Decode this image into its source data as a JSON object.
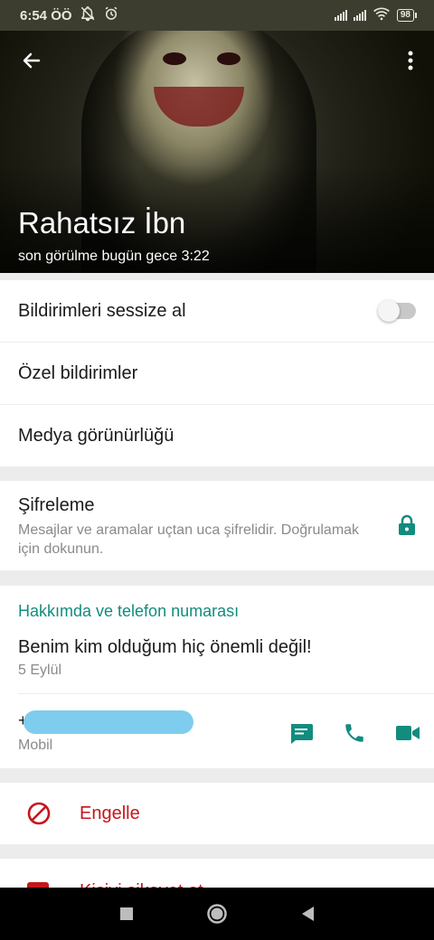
{
  "status_bar": {
    "time": "6:54 ÖÖ",
    "battery": "98"
  },
  "header": {
    "contact_name": "Rahatsız İbn",
    "last_seen": "son görülme bugün gece 3:22"
  },
  "settings": {
    "mute": "Bildirimleri sessize al",
    "mute_enabled": false,
    "custom_notifications": "Özel bildirimler",
    "media_visibility": "Medya görünürlüğü"
  },
  "encryption": {
    "title": "Şifreleme",
    "description": "Mesajlar ve aramalar uçtan uca şifrelidir. Doğrulamak için dokunun."
  },
  "about": {
    "section_title": "Hakkımda ve telefon numarası",
    "text": "Benim kim olduğum hiç önemli değil!",
    "date": "5 Eylül",
    "phone_prefix": "+",
    "phone_type": "Mobil"
  },
  "actions": {
    "block": "Engelle",
    "report_partial": "Kişiyi şikayet et"
  },
  "colors": {
    "accent": "#128c7e",
    "danger": "#c4161c",
    "redaction": "#7fcdee"
  },
  "icons": {
    "back": "arrow-left-icon",
    "menu": "more-vert-icon",
    "lock": "lock-icon",
    "message": "message-icon",
    "call": "phone-icon",
    "video": "videocam-icon",
    "block": "block-icon"
  }
}
